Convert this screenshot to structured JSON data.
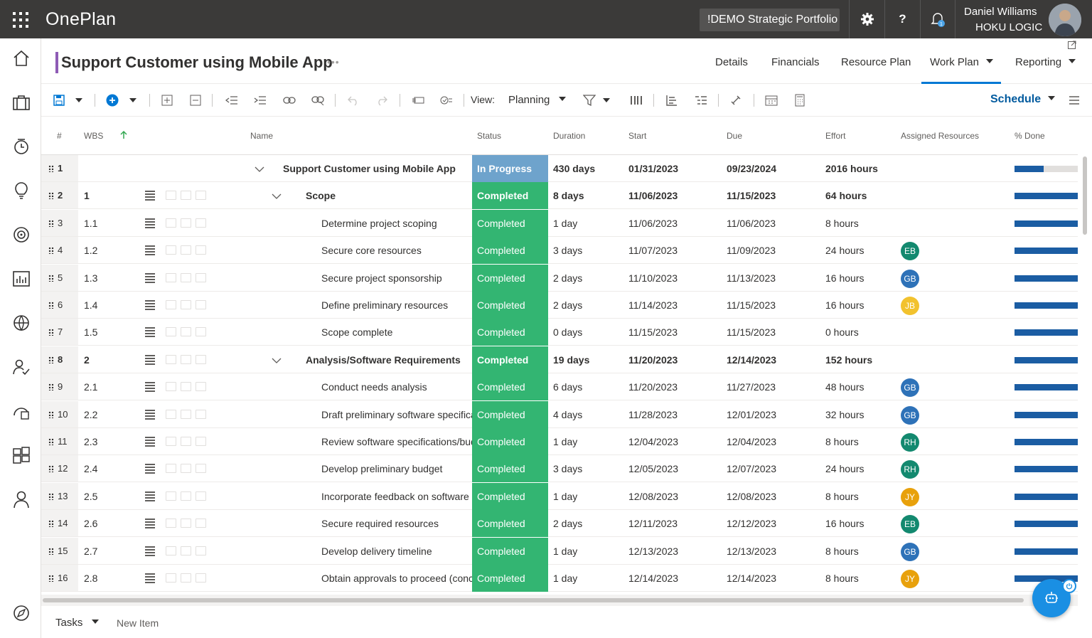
{
  "topbar": {
    "app_title": "OnePlan",
    "portfolio": "!DEMO Strategic Portfolio M",
    "user_name": "Daniel Williams",
    "user_org": "HOKU LOGIC",
    "notification_count": "1"
  },
  "header": {
    "title": "Support Customer using Mobile App",
    "more": "•••",
    "tabs": [
      {
        "label": "Details"
      },
      {
        "label": "Financials"
      },
      {
        "label": "Resource Plan"
      },
      {
        "label": "Work Plan"
      },
      {
        "label": "Reporting"
      }
    ],
    "active_tab": "Work Plan"
  },
  "toolbar": {
    "view_label": "View:",
    "view_value": "Planning",
    "schedule_label": "Schedule"
  },
  "grid": {
    "columns": [
      "#",
      "WBS",
      "Name",
      "Status",
      "Duration",
      "Start",
      "Due",
      "Effort",
      "Assigned Resources",
      "% Done"
    ],
    "rows": [
      {
        "num": "1",
        "wbs": "",
        "name": "Support Customer using Mobile App",
        "status": "In Progress",
        "duration": "430 days",
        "start": "01/31/2023",
        "due": "09/23/2024",
        "effort": "2016 hours",
        "resource": "",
        "pct": 0.46,
        "level": 0,
        "summary": true
      },
      {
        "num": "2",
        "wbs": "1",
        "name": "Scope",
        "status": "Completed",
        "duration": "8 days",
        "start": "11/06/2023",
        "due": "11/15/2023",
        "effort": "64 hours",
        "resource": "",
        "pct": 1,
        "level": 1,
        "summary": true
      },
      {
        "num": "3",
        "wbs": "1.1",
        "name": "Determine project scoping",
        "status": "Completed",
        "duration": "1 day",
        "start": "11/06/2023",
        "due": "11/06/2023",
        "effort": "8 hours",
        "resource": "",
        "pct": 1,
        "level": 2
      },
      {
        "num": "4",
        "wbs": "1.2",
        "name": "Secure core resources",
        "status": "Completed",
        "duration": "3 days",
        "start": "11/07/2023",
        "due": "11/09/2023",
        "effort": "24 hours",
        "resource": "EB",
        "pct": 1,
        "level": 2
      },
      {
        "num": "5",
        "wbs": "1.3",
        "name": "Secure project sponsorship",
        "status": "Completed",
        "duration": "2 days",
        "start": "11/10/2023",
        "due": "11/13/2023",
        "effort": "16 hours",
        "resource": "GB",
        "pct": 1,
        "level": 2
      },
      {
        "num": "6",
        "wbs": "1.4",
        "name": "Define preliminary resources",
        "status": "Completed",
        "duration": "2 days",
        "start": "11/14/2023",
        "due": "11/15/2023",
        "effort": "16 hours",
        "resource": "JB",
        "pct": 1,
        "level": 2
      },
      {
        "num": "7",
        "wbs": "1.5",
        "name": "Scope complete",
        "status": "Completed",
        "duration": "0 days",
        "start": "11/15/2023",
        "due": "11/15/2023",
        "effort": "0 hours",
        "resource": "",
        "pct": 1,
        "level": 2
      },
      {
        "num": "8",
        "wbs": "2",
        "name": "Analysis/Software Requirements",
        "status": "Completed",
        "duration": "19 days",
        "start": "11/20/2023",
        "due": "12/14/2023",
        "effort": "152 hours",
        "resource": "",
        "pct": 1,
        "level": 1,
        "summary": true
      },
      {
        "num": "9",
        "wbs": "2.1",
        "name": "Conduct needs analysis",
        "status": "Completed",
        "duration": "6 days",
        "start": "11/20/2023",
        "due": "11/27/2023",
        "effort": "48 hours",
        "resource": "GB",
        "pct": 1,
        "level": 2
      },
      {
        "num": "10",
        "wbs": "2.2",
        "name": "Draft preliminary software specifica",
        "status": "Completed",
        "duration": "4 days",
        "start": "11/28/2023",
        "due": "12/01/2023",
        "effort": "32 hours",
        "resource": "GB",
        "pct": 1,
        "level": 2
      },
      {
        "num": "11",
        "wbs": "2.3",
        "name": "Review software specifications/bud",
        "status": "Completed",
        "duration": "1 day",
        "start": "12/04/2023",
        "due": "12/04/2023",
        "effort": "8 hours",
        "resource": "RH",
        "pct": 1,
        "level": 2
      },
      {
        "num": "12",
        "wbs": "2.4",
        "name": "Develop preliminary budget",
        "status": "Completed",
        "duration": "3 days",
        "start": "12/05/2023",
        "due": "12/07/2023",
        "effort": "24 hours",
        "resource": "RH",
        "pct": 1,
        "level": 2
      },
      {
        "num": "13",
        "wbs": "2.5",
        "name": "Incorporate feedback on software s",
        "status": "Completed",
        "duration": "1 day",
        "start": "12/08/2023",
        "due": "12/08/2023",
        "effort": "8 hours",
        "resource": "JY",
        "pct": 1,
        "level": 2
      },
      {
        "num": "14",
        "wbs": "2.6",
        "name": "Secure required resources",
        "status": "Completed",
        "duration": "2 days",
        "start": "12/11/2023",
        "due": "12/12/2023",
        "effort": "16 hours",
        "resource": "EB",
        "pct": 1,
        "level": 2
      },
      {
        "num": "15",
        "wbs": "2.7",
        "name": "Develop delivery timeline",
        "status": "Completed",
        "duration": "1 day",
        "start": "12/13/2023",
        "due": "12/13/2023",
        "effort": "8 hours",
        "resource": "GB",
        "pct": 1,
        "level": 2
      },
      {
        "num": "16",
        "wbs": "2.8",
        "name": "Obtain approvals to proceed (conc",
        "status": "Completed",
        "duration": "1 day",
        "start": "12/14/2023",
        "due": "12/14/2023",
        "effort": "8 hours",
        "resource": "JY",
        "pct": 1,
        "level": 2
      }
    ]
  },
  "resource_colors": {
    "EB": "#13896f",
    "GB": "#2e72b8",
    "JB": "#f2c22e",
    "RH": "#13896f",
    "JY": "#e8a10c"
  },
  "status_colors": {
    "Completed": "#33b572",
    "In Progress": "#6ea3cc"
  },
  "bottom": {
    "tasks_label": "Tasks",
    "new_item_label": "New Item"
  }
}
